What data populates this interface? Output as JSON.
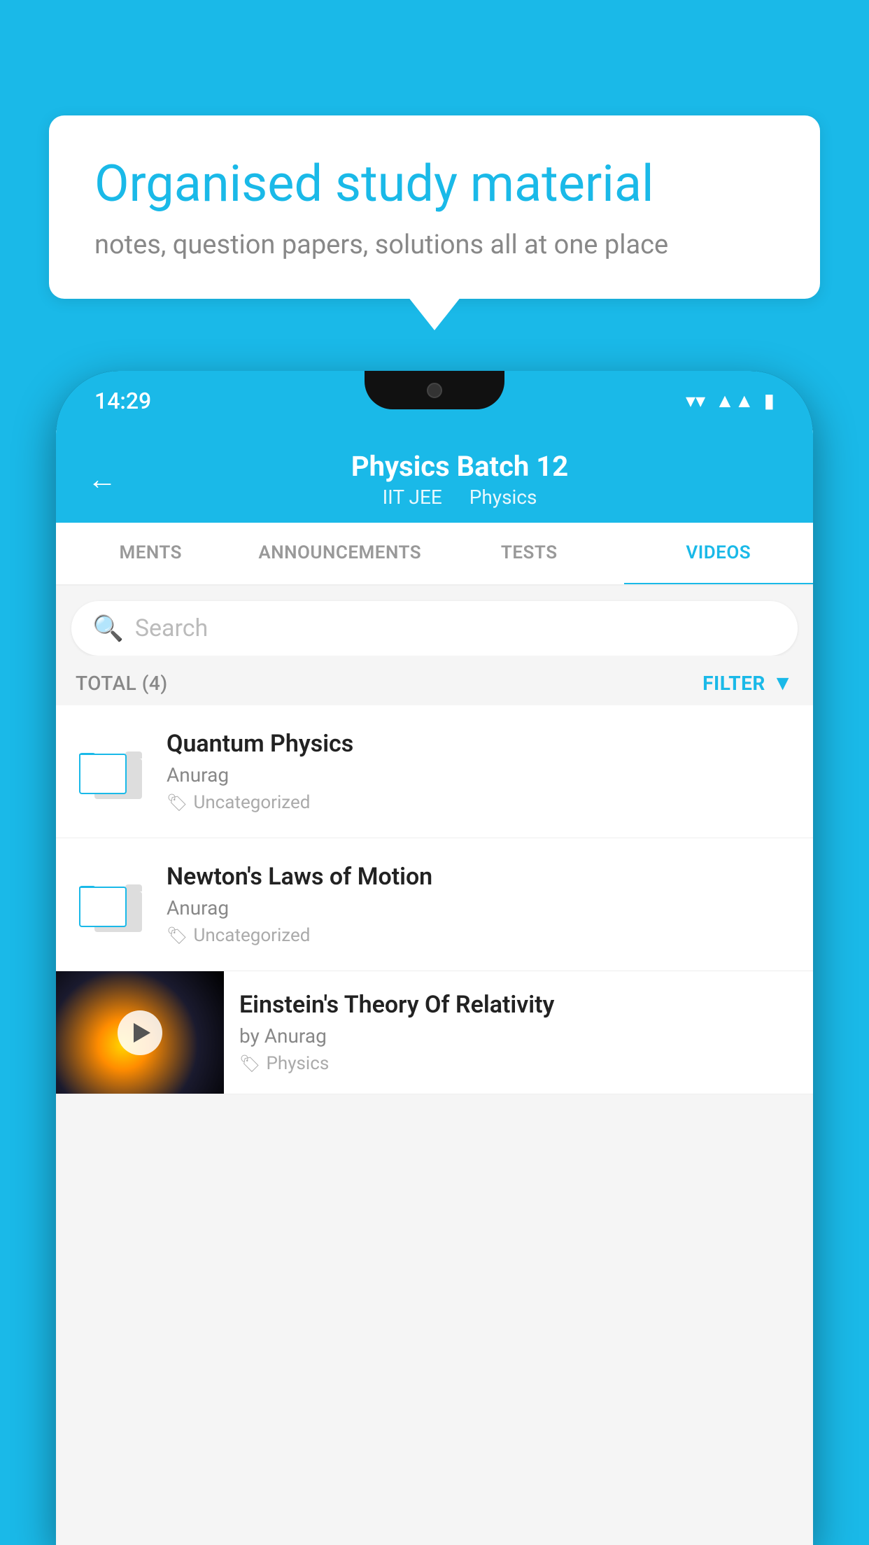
{
  "background_color": "#1ab9e8",
  "bubble": {
    "title": "Organised study material",
    "subtitle": "notes, question papers, solutions all at one place"
  },
  "phone": {
    "status_bar": {
      "time": "14:29",
      "icons": [
        "wifi",
        "signal",
        "battery"
      ]
    },
    "header": {
      "back_label": "←",
      "title": "Physics Batch 12",
      "tag1": "IIT JEE",
      "tag2": "Physics"
    },
    "tabs": [
      {
        "label": "MENTS",
        "active": false
      },
      {
        "label": "ANNOUNCEMENTS",
        "active": false
      },
      {
        "label": "TESTS",
        "active": false
      },
      {
        "label": "VIDEOS",
        "active": true
      }
    ],
    "search": {
      "placeholder": "Search"
    },
    "filter_bar": {
      "total_label": "TOTAL (4)",
      "filter_label": "FILTER"
    },
    "items": [
      {
        "type": "folder",
        "title": "Quantum Physics",
        "author": "Anurag",
        "tag": "Uncategorized"
      },
      {
        "type": "folder",
        "title": "Newton's Laws of Motion",
        "author": "Anurag",
        "tag": "Uncategorized"
      },
      {
        "type": "video",
        "title": "Einstein's Theory Of Relativity",
        "author": "by Anurag",
        "tag": "Physics"
      }
    ]
  }
}
